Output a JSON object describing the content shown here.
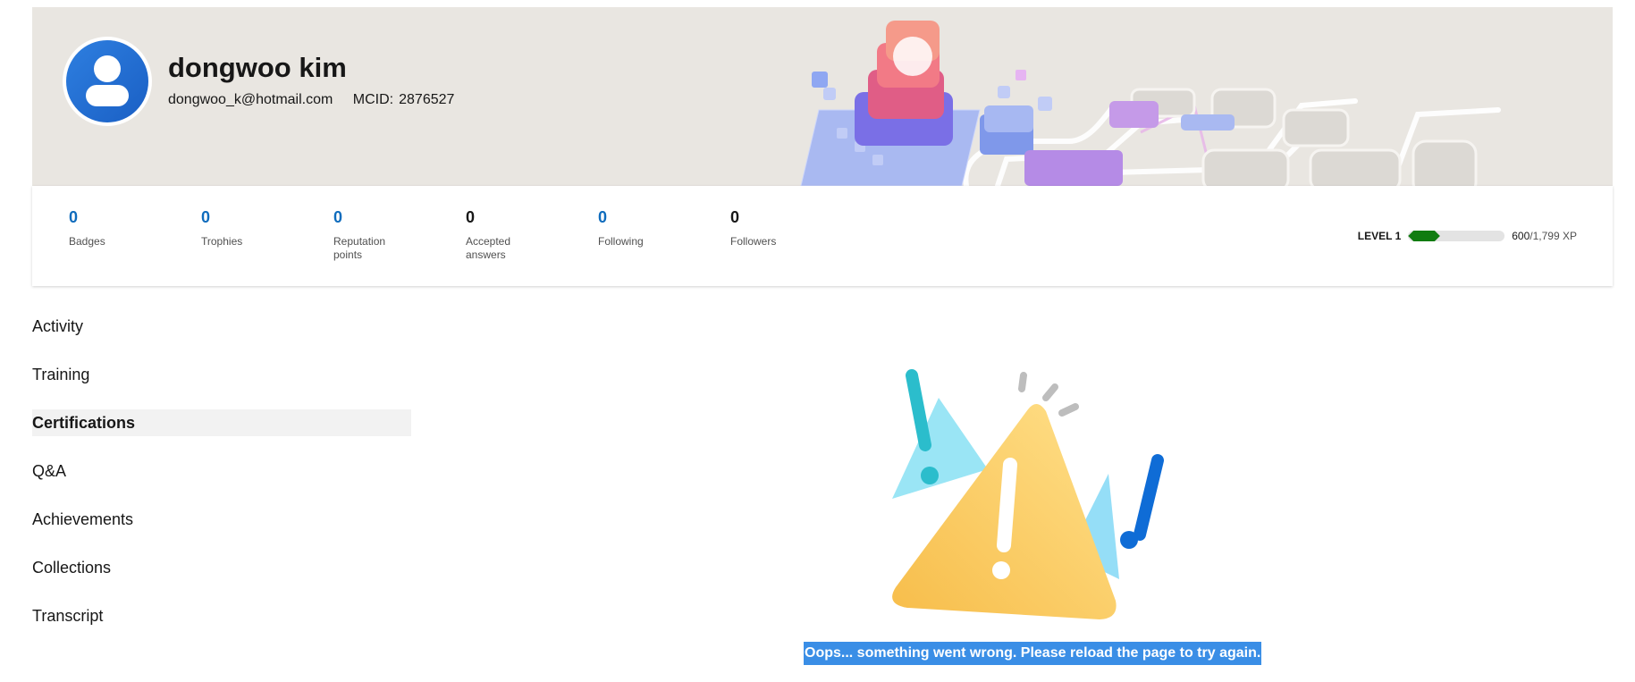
{
  "profile": {
    "name": "dongwoo kim",
    "email": "dongwoo_k@hotmail.com",
    "mcid_label": "MCID:",
    "mcid": "2876527"
  },
  "stats": [
    {
      "value": "0",
      "label": "Badges"
    },
    {
      "value": "0",
      "label": "Trophies"
    },
    {
      "value": "0",
      "label": "Reputation points"
    },
    {
      "value": "0",
      "label": "Accepted answers"
    },
    {
      "value": "0",
      "label": "Following"
    },
    {
      "value": "0",
      "label": "Followers"
    }
  ],
  "level": {
    "label": "LEVEL 1",
    "xp_current": "600",
    "xp_total": "/1,799 XP",
    "progress_fraction": 0.33,
    "progress_color": "#107c10"
  },
  "nav": {
    "items": [
      "Activity",
      "Training",
      "Certifications",
      "Q&A",
      "Achievements",
      "Collections",
      "Transcript"
    ],
    "active": "Certifications"
  },
  "error": {
    "message": "Oops... something went wrong. Please reload the page to try again.",
    "icon": "warning-triangle-icon"
  },
  "colors": {
    "accent": "#0f6cbd",
    "banner_bg": "#e9e6e1",
    "selection": "#3a8ee6"
  }
}
